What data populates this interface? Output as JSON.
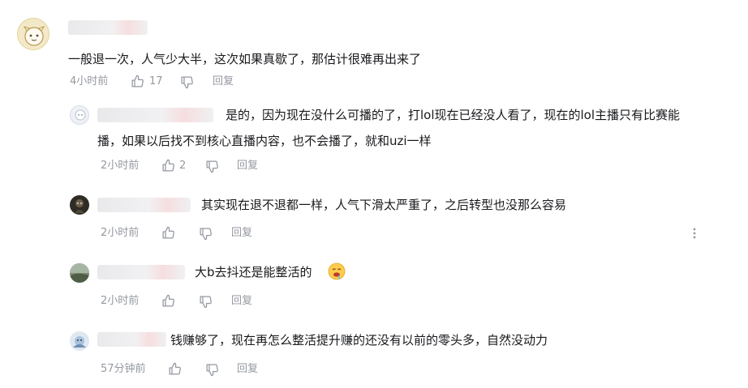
{
  "comments": [
    {
      "text": "一般退一次，人气少大半，这次如果真歇了，那估计很难再出来了",
      "time": "4小时前",
      "likes": "17",
      "reply_label": "回复"
    }
  ],
  "replies": [
    {
      "text_line1": "是的，因为现在没什么可播的了，打lol现在已经没人看了，现在的lol主播只有比赛能",
      "text_line2": "播，如果以后找不到核心直播内容，也不会播了，就和uzi一样",
      "time": "2小时前",
      "likes": "2",
      "reply_label": "回复"
    },
    {
      "text": "其实现在退不退都一样，人气下滑太严重了，之后转型也没那么容易",
      "time": "2小时前",
      "likes": "",
      "reply_label": "回复"
    },
    {
      "text": "大b去抖还是能整活的",
      "emoji": "🤤",
      "time": "2小时前",
      "likes": "",
      "reply_label": "回复"
    },
    {
      "text": "钱赚够了，现在再怎么整活提升赚的还没有以前的零头多，自然没动力",
      "time": "57分钟前",
      "likes": "",
      "reply_label": "回复"
    }
  ],
  "colors": {
    "text": "#18191c",
    "meta": "#9499a0"
  },
  "icons": [
    "like-icon",
    "dislike-icon",
    "more-icon"
  ]
}
